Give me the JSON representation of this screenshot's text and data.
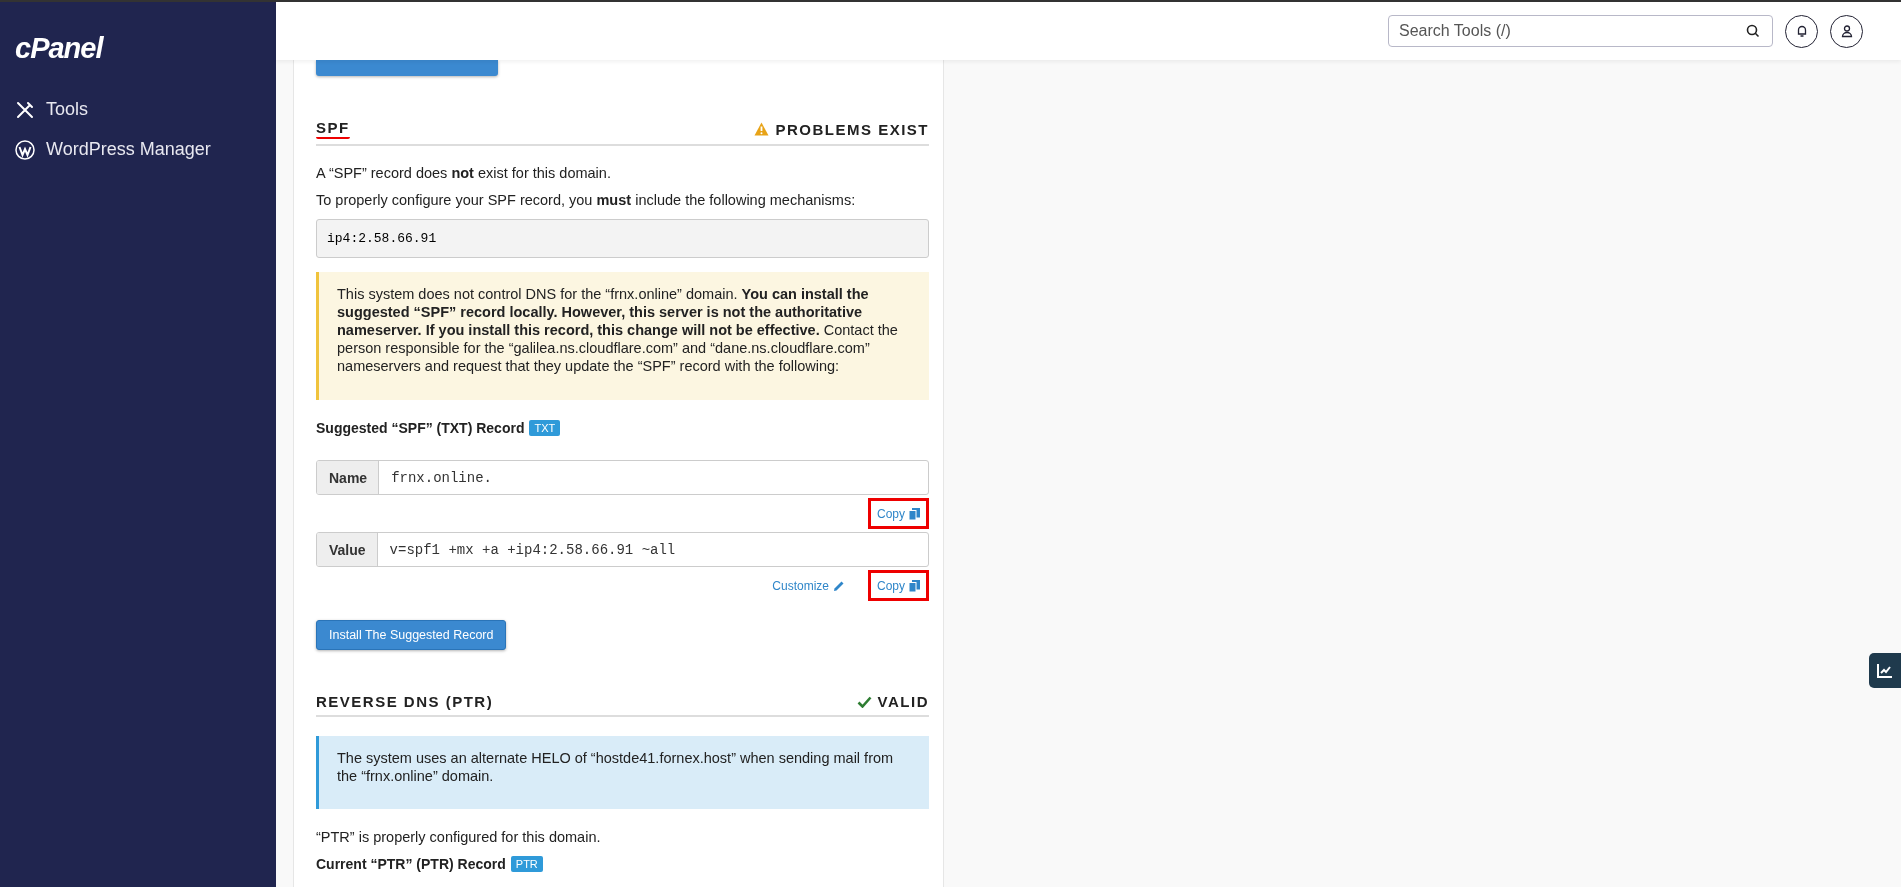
{
  "sidebar": {
    "logo": "cPanel",
    "items": [
      {
        "kind": "tools",
        "label": "Tools"
      },
      {
        "kind": "wordpress",
        "label": "WordPress Manager"
      }
    ]
  },
  "header": {
    "search": {
      "placeholder": "Search Tools (/)"
    }
  },
  "sections": [
    {
      "title": "SPF",
      "underlined": true,
      "status": {
        "kind": "warning",
        "label": "PROBLEMS EXIST"
      },
      "blocks": [
        {
          "kind": "text",
          "text": "A “SPF” record does **not** exist for this domain."
        },
        {
          "kind": "text",
          "text": "To properly configure your SPF record, you **must** include the following mechanisms:"
        },
        {
          "kind": "code",
          "text": "ip4:2.58.66.91"
        },
        {
          "kind": "warning_alert",
          "text": "This system does not control DNS for the “frnx.online” domain. **You can install the suggested “SPF” record locally. However, this server is not the authoritative nameserver. If you install this record, this change will not be effective.** Contact the person responsible for the “galilea.ns.cloudflare.com” and “dane.ns.cloudflare.com” nameservers and request that they update the “SPF” record with the following:"
        },
        {
          "kind": "record",
          "title": "Suggested “SPF” (TXT) Record",
          "badge": "TXT",
          "fields": [
            {
              "label": "Name",
              "value": "frnx.online.",
              "actions": [
                {
                  "kind": "copy",
                  "label": "Copy",
                  "highlighted": true
                }
              ]
            },
            {
              "label": "Value",
              "value": "v=spf1 +mx +a +ip4:2.58.66.91 ~all",
              "actions": [
                {
                  "kind": "customize",
                  "label": "Customize",
                  "highlighted": false
                },
                {
                  "kind": "copy",
                  "label": "Copy",
                  "highlighted": true
                }
              ]
            }
          ]
        },
        {
          "kind": "button",
          "text": "Install The Suggested Record"
        }
      ]
    },
    {
      "title": "REVERSE DNS (PTR)",
      "underlined": false,
      "status": {
        "kind": "valid",
        "label": "VALID"
      },
      "blocks": [
        {
          "kind": "info_alert",
          "text": "The system uses an alternate HELO of “hostde41.fornex.host” when sending mail from the “frnx.online” domain."
        },
        {
          "kind": "text",
          "text": "“PTR” is properly configured for this domain."
        },
        {
          "kind": "record",
          "title": "Current “PTR” (PTR) Record",
          "badge": "PTR"
        }
      ]
    }
  ]
}
